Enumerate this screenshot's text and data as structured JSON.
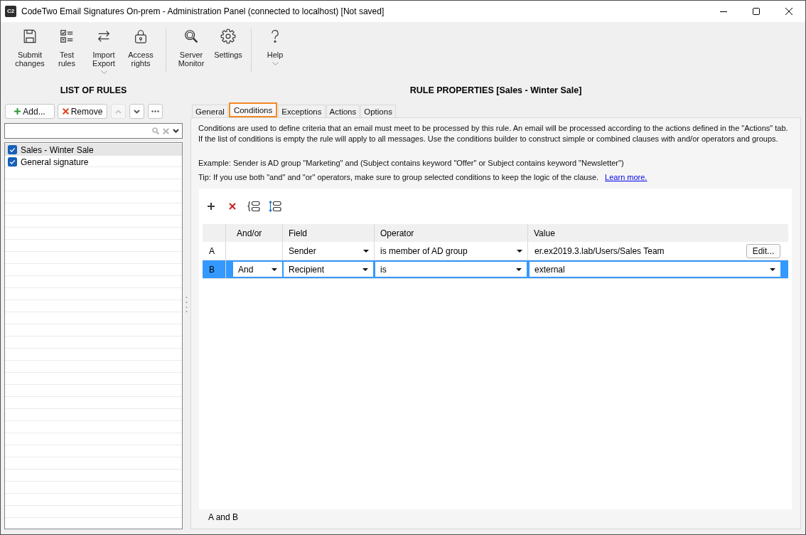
{
  "window": {
    "logo": "C2",
    "title": "CodeTwo Email Signatures On-prem - Administration Panel (connected to localhost) [Not saved]"
  },
  "toolbar": {
    "groups": [
      {
        "buttons": [
          {
            "label": "Submit\nchanges",
            "dropdown": false
          },
          {
            "label": "Test\nrules",
            "dropdown": false
          },
          {
            "label": "Import\nExport",
            "dropdown": true
          },
          {
            "label": "Access\nrights",
            "dropdown": false
          }
        ]
      },
      {
        "buttons": [
          {
            "label": "Server\nMonitor",
            "dropdown": false
          },
          {
            "label": "Settings",
            "dropdown": false
          }
        ]
      },
      {
        "buttons": [
          {
            "label": "Help",
            "dropdown": true
          }
        ]
      }
    ]
  },
  "rules_panel": {
    "title": "LIST OF RULES",
    "buttons": [
      {
        "kind": "add",
        "label": "Add...",
        "disabled": false
      },
      {
        "kind": "remove",
        "label": "Remove",
        "disabled": false
      },
      {
        "kind": "up",
        "disabled": true
      },
      {
        "kind": "down",
        "disabled": false
      },
      {
        "kind": "more",
        "disabled": false
      }
    ],
    "rules": [
      {
        "name": "Sales - Winter Sale",
        "checked": true,
        "selected": true
      },
      {
        "name": "General signature",
        "checked": true,
        "selected": false
      }
    ]
  },
  "properties": {
    "title": "RULE PROPERTIES [Sales - Winter Sale]",
    "tabs": [
      {
        "label": "General",
        "selected": false
      },
      {
        "label": "Conditions",
        "selected": true
      },
      {
        "label": "Exceptions",
        "selected": false
      },
      {
        "label": "Actions",
        "selected": false
      },
      {
        "label": "Options",
        "selected": false
      }
    ],
    "description": "Conditions are used to define criteria that an email must meet to be processed by this rule. An email will be processed according to the actions defined in the \"Actions\" tab. If the list of conditions is empty the rule will apply to all messages. Use the conditions builder to construct simple or combined clauses with and/or operators and groups.",
    "example": "Example: Sender is AD group \"Marketing\" and (Subject contains keyword \"Offer\" or Subject contains keyword \"Newsletter\")",
    "tip": "Tip: If you use both \"and\" and \"or\" operators, make sure to group selected conditions to keep the logic of the clause.",
    "tip_link": "Learn more.",
    "conditions": {
      "columns": [
        "And/or",
        "Field",
        "Operator",
        "Value"
      ],
      "rows": [
        {
          "label": "A",
          "selected": false,
          "cells": [
            {
              "kind": "blank"
            },
            {
              "kind": "dropdown",
              "text": "Sender"
            },
            {
              "kind": "dropdown",
              "text": "is member of AD group"
            },
            {
              "kind": "edit",
              "text": "er.ex2019.3.lab/Users/Sales Team",
              "button": "Edit..."
            }
          ]
        },
        {
          "label": "B",
          "selected": true,
          "cells": [
            {
              "kind": "dropdown",
              "text": "And"
            },
            {
              "kind": "dropdown",
              "text": "Recipient"
            },
            {
              "kind": "dropdown",
              "text": "is"
            },
            {
              "kind": "dropdown",
              "text": "external"
            }
          ]
        }
      ]
    },
    "expression": "A and B"
  }
}
